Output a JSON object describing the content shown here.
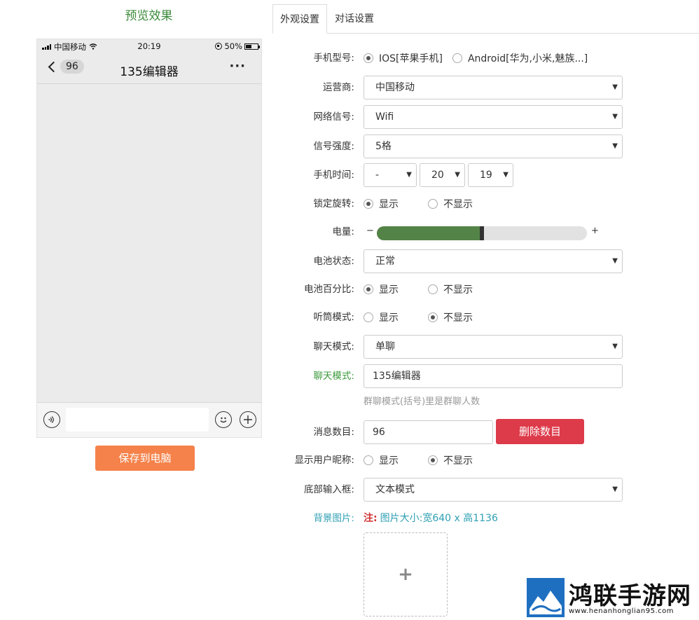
{
  "preview": {
    "title": "预览效果",
    "status_bar": {
      "carrier": "中国移动",
      "time": "20:19",
      "battery_percent": "50%",
      "battery_level": 0.5
    },
    "nav": {
      "badge_count": "96",
      "title": "135编辑器",
      "more": "···"
    },
    "save_button": "保存到电脑"
  },
  "tabs": [
    "外观设置",
    "对话设置"
  ],
  "settings": {
    "phone_model": {
      "label": "手机型号:",
      "options": [
        "IOS[苹果手机]",
        "Android[华为,小米,魅族...]"
      ],
      "selected": 0
    },
    "carrier": {
      "label": "运营商:",
      "value": "中国移动"
    },
    "network": {
      "label": "网络信号:",
      "value": "Wifi"
    },
    "signal_strength": {
      "label": "信号强度:",
      "value": "5格"
    },
    "phone_time": {
      "label": "手机时间:",
      "period": "-",
      "hour": "20",
      "minute": "19"
    },
    "lock_rotation": {
      "label": "锁定旋转:",
      "options": [
        "显示",
        "不显示"
      ],
      "selected": 0
    },
    "battery": {
      "label": "电量:",
      "minus": "−",
      "plus": "+",
      "level": 0.5
    },
    "battery_status": {
      "label": "电池状态:",
      "value": "正常"
    },
    "battery_percent": {
      "label": "电池百分比:",
      "options": [
        "显示",
        "不显示"
      ],
      "selected": 0
    },
    "earpiece_mode": {
      "label": "听筒模式:",
      "options": [
        "显示",
        "不显示"
      ],
      "selected": 1
    },
    "chat_mode": {
      "label": "聊天模式:",
      "value": "单聊"
    },
    "chat_name": {
      "label": "聊天模式:",
      "value": "135编辑器",
      "hint": "群聊模式(括号)里是群聊人数"
    },
    "message_count": {
      "label": "消息数目:",
      "value": "96",
      "delete_button": "删除数目"
    },
    "show_nickname": {
      "label": "显示用户昵称:",
      "options": [
        "显示",
        "不显示"
      ],
      "selected": 1
    },
    "bottom_input": {
      "label": "底部输入框:",
      "value": "文本模式"
    },
    "background": {
      "label": "背景图片:",
      "note_prefix": "注:",
      "note": "图片大小:宽640 x 高1136",
      "upload": "+"
    }
  },
  "watermark": {
    "text": "鸿联手游网",
    "url": "www.henanhonglian95.com"
  },
  "colors": {
    "accent_green": "#3c8b3c",
    "battery_fill": "#548347",
    "save_orange": "#f5824a",
    "delete_red": "#dd3a4a",
    "teal": "#2fa0b3"
  }
}
